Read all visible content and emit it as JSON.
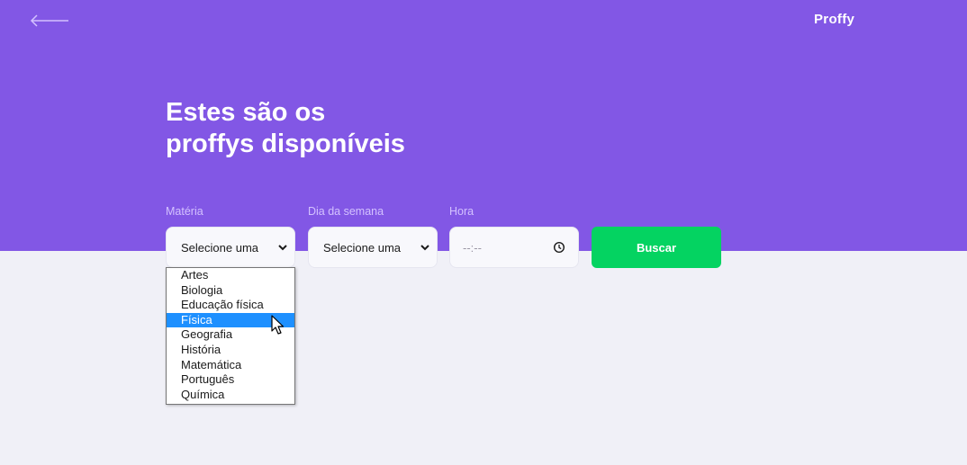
{
  "app": {
    "brand": "Proffy",
    "back_icon": "arrow-left-icon"
  },
  "hero": {
    "title_line1": "Estes são os",
    "title_line2": "proffys disponíveis"
  },
  "filters": {
    "materia": {
      "label": "Matéria",
      "selected": "Selecione uma",
      "options": [
        "Artes",
        "Biologia",
        "Educação física",
        "Física",
        "Geografia",
        "História",
        "Matemática",
        "Português",
        "Química"
      ],
      "highlighted": "Física"
    },
    "dia": {
      "label": "Dia da semana",
      "selected": "Selecione uma"
    },
    "hora": {
      "label": "Hora",
      "value": "--:--",
      "icon": "clock-icon"
    },
    "buscar_label": "Buscar"
  },
  "colors": {
    "primary": "#8257e5",
    "background": "#f0f0f7",
    "button": "#04d361",
    "label": "#d4c2ff",
    "highlight": "#1e90ff"
  }
}
